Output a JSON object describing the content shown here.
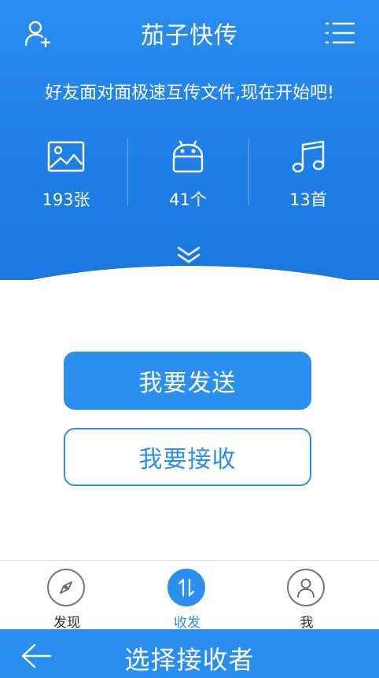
{
  "header": {
    "title": "茄子快传",
    "left_icon": "add-user-icon",
    "right_icon": "menu-icon",
    "subtitle": "好友面对面极速互传文件,现在开始吧!"
  },
  "stats": [
    {
      "icon": "image-icon",
      "label": "193张"
    },
    {
      "icon": "android-icon",
      "label": "41个"
    },
    {
      "icon": "music-icon",
      "label": "13首"
    }
  ],
  "expand_icon": "double-chevron-down-icon",
  "actions": {
    "send_label": "我要发送",
    "receive_label": "我要接收"
  },
  "tabs": [
    {
      "label": "发现",
      "icon": "compass-icon",
      "active": false
    },
    {
      "label": "收发",
      "icon": "transfer-icon",
      "active": true
    },
    {
      "label": "我",
      "icon": "person-icon",
      "active": false
    }
  ],
  "bottom_bar": {
    "title": "选择接收者",
    "back_icon": "arrow-left-icon"
  },
  "colors": {
    "primary": "#2b8ff0",
    "hero_top": "#2a8df0",
    "hero_bottom": "#1a77de",
    "tab_inactive": "#777777"
  }
}
